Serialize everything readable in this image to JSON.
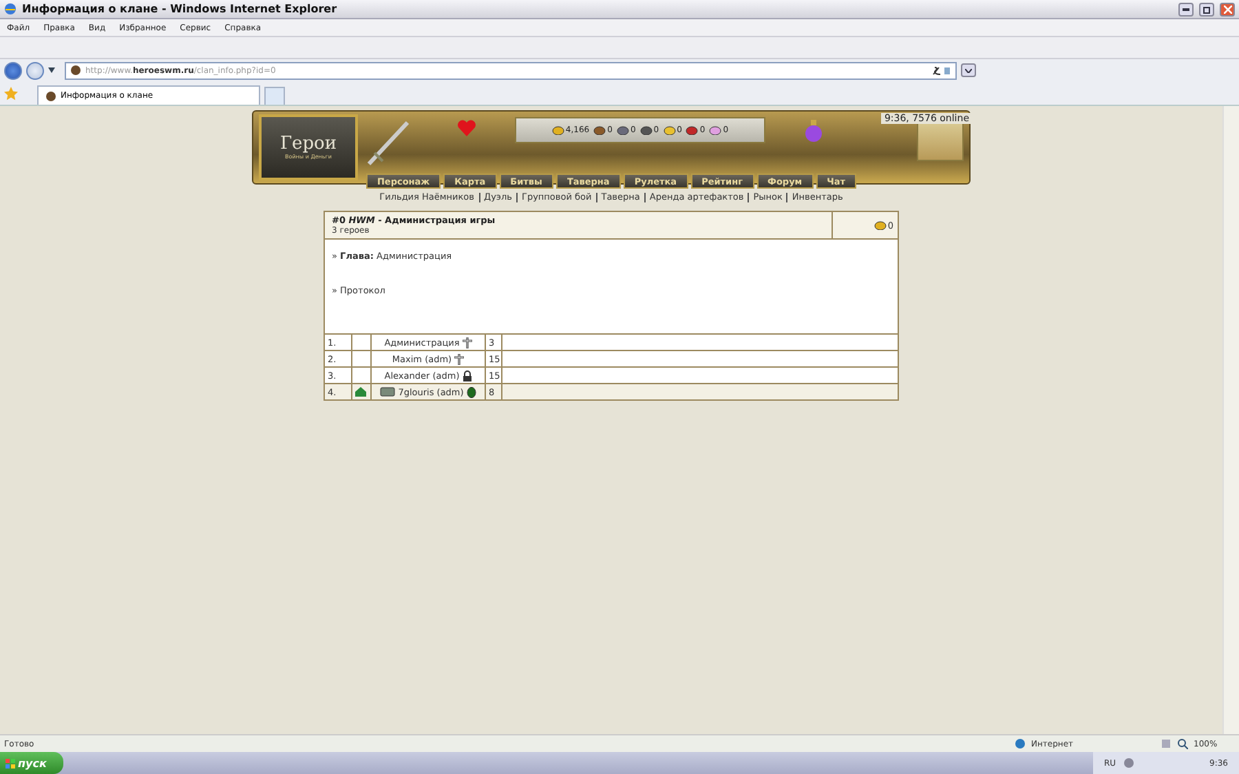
{
  "window": {
    "title": "Информация о клане - Windows Internet Explorer"
  },
  "menu": [
    "Файл",
    "Правка",
    "Вид",
    "Избранное",
    "Сервис",
    "Справка"
  ],
  "address": {
    "url": "http://www.**heroeswm.ru**/clan_info.php?id=0"
  },
  "tabs": [
    {
      "label": "Информация о клане",
      "selected": true
    }
  ],
  "game_header": {
    "logo_title": "Герои",
    "logo_subtitle": "Войны и Деньги",
    "online": "9:36, 7576 online",
    "resources": [
      {
        "kind": "gold",
        "value": "4,166"
      },
      {
        "kind": "wood",
        "value": "0"
      },
      {
        "kind": "ore",
        "value": "0"
      },
      {
        "kind": "mercury",
        "value": "0"
      },
      {
        "kind": "sulfur",
        "value": "0"
      },
      {
        "kind": "crystal",
        "value": "0"
      },
      {
        "kind": "gems",
        "value": "0"
      }
    ],
    "nav": [
      "Персонаж",
      "Карта",
      "Битвы",
      "Таверна",
      "Рулетка",
      "Рейтинг",
      "Форум",
      "Чат"
    ],
    "links": [
      "Гильдия Наёмников",
      "Дуэль",
      "Групповой бой",
      "Таверна",
      "Аренда артефактов",
      "Рынок",
      "Инвентарь"
    ]
  },
  "clan": {
    "title": "#0 *HWM* - Администрация игры",
    "count": "3 героев",
    "gold": "0",
    "leader": "» **Глава:** Администрация",
    "protocol": "» Протокол",
    "members": [
      {
        "num": "1.",
        "name": "Администрация",
        "level": "3",
        "kind": "cross",
        "house": false,
        "badge": false
      },
      {
        "num": "2.",
        "name": "Maxim (adm)",
        "level": "15",
        "kind": "cross",
        "house": false,
        "badge": false
      },
      {
        "num": "3.",
        "name": "Alexander (adm)",
        "level": "15",
        "kind": "lock",
        "house": false,
        "badge": false
      },
      {
        "num": "4.",
        "name": "7glouris (adm)",
        "level": "8",
        "kind": "leaf",
        "house": true,
        "badge": true
      }
    ]
  },
  "status_bar": {
    "text": "Готово",
    "zone": "Интернет",
    "zoom": "100%"
  },
  "taskbar": {
    "start": "пуск",
    "lang": "RU",
    "clock": "9:36"
  }
}
